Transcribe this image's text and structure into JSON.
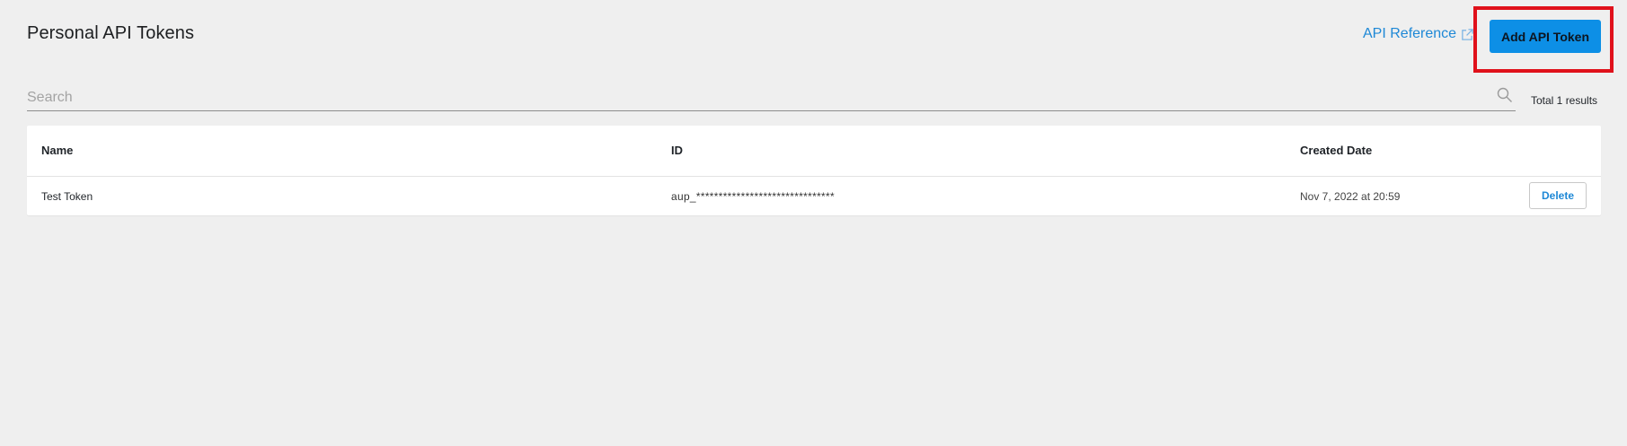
{
  "header": {
    "title": "Personal API Tokens",
    "api_reference_label": "API Reference",
    "api_reference_icon": "external-link-icon",
    "add_button_label": "Add API Token"
  },
  "search": {
    "placeholder": "Search",
    "value": "",
    "icon": "search-icon",
    "total_results": "Total 1 results"
  },
  "table": {
    "columns": [
      "Name",
      "ID",
      "Created Date"
    ],
    "rows": [
      {
        "name": "Test Token",
        "id": "aup_*******************************",
        "created": "Nov 7, 2022 at 20:59",
        "action_label": "Delete"
      }
    ]
  },
  "colors": {
    "accent": "#0d8fe6",
    "link": "#1e88d6",
    "highlight": "#e0111b",
    "background": "#efefef"
  }
}
